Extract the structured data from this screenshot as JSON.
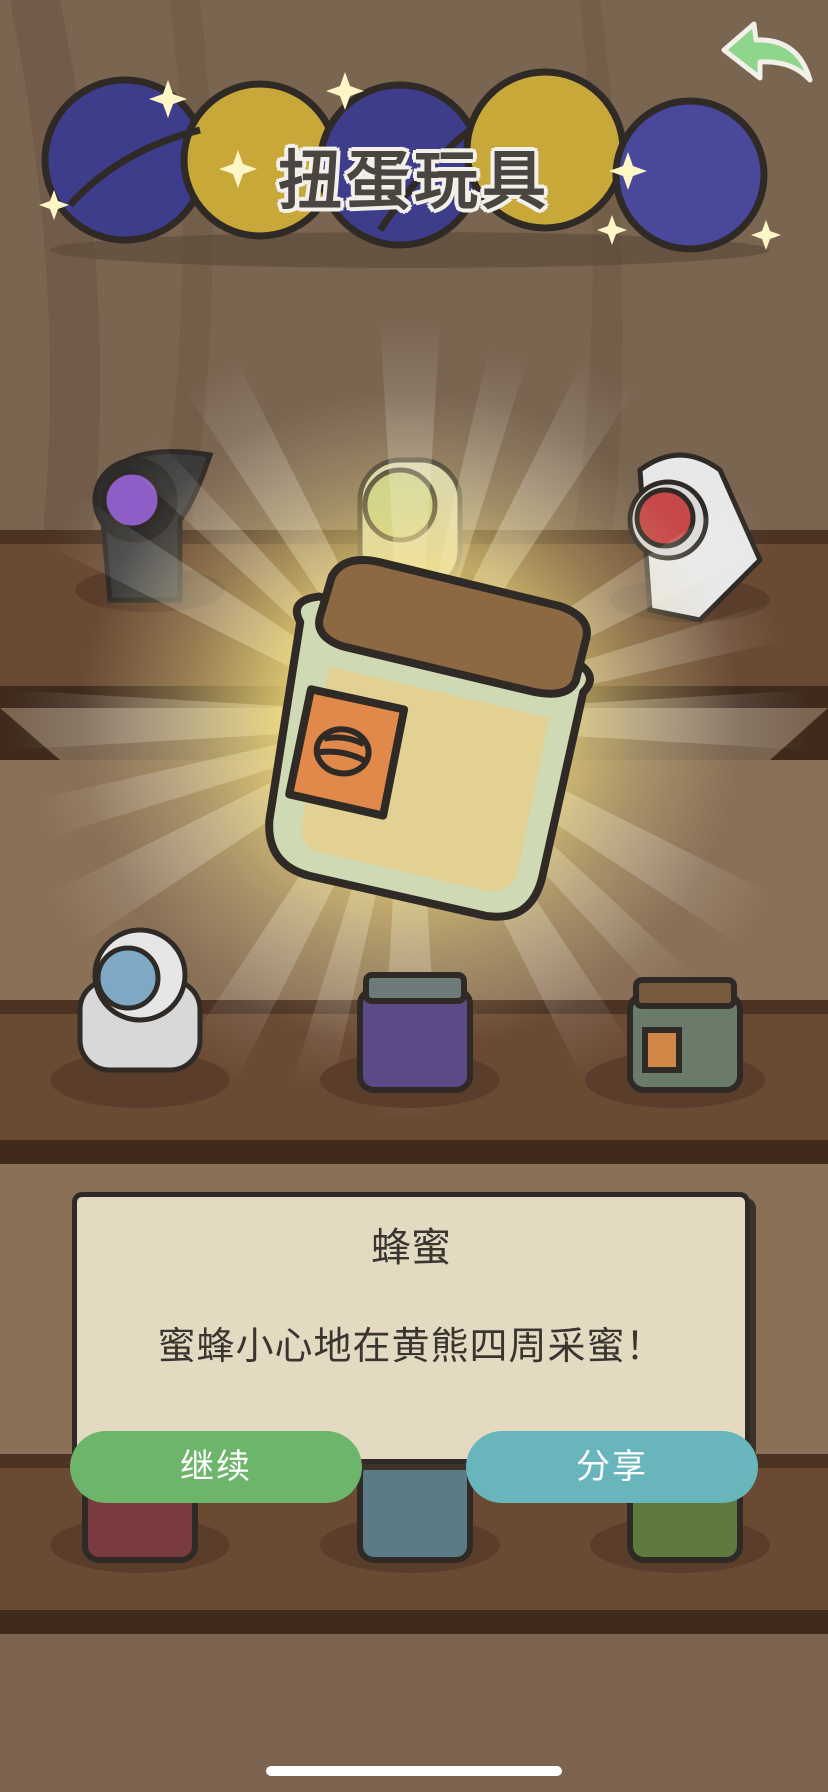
{
  "title": "扭蛋玩具",
  "item": {
    "name": "蜂蜜",
    "description": "蜜蜂小心地在黄熊四周采蜜！"
  },
  "buttons": {
    "continue": "继续",
    "share": "分享"
  },
  "colors": {
    "background": "#6e5a47",
    "shelf": "#5b3f2c",
    "dialog_bg": "#e4dac2",
    "continue_button": "#6cb56a",
    "share_button": "#68b5bb",
    "back_arrow": "#8fd68c"
  },
  "icons": [
    "back-arrow-icon",
    "honey-jar-icon",
    "capsule-ball-icon",
    "astronaut-figure-icon",
    "jar-icon"
  ]
}
